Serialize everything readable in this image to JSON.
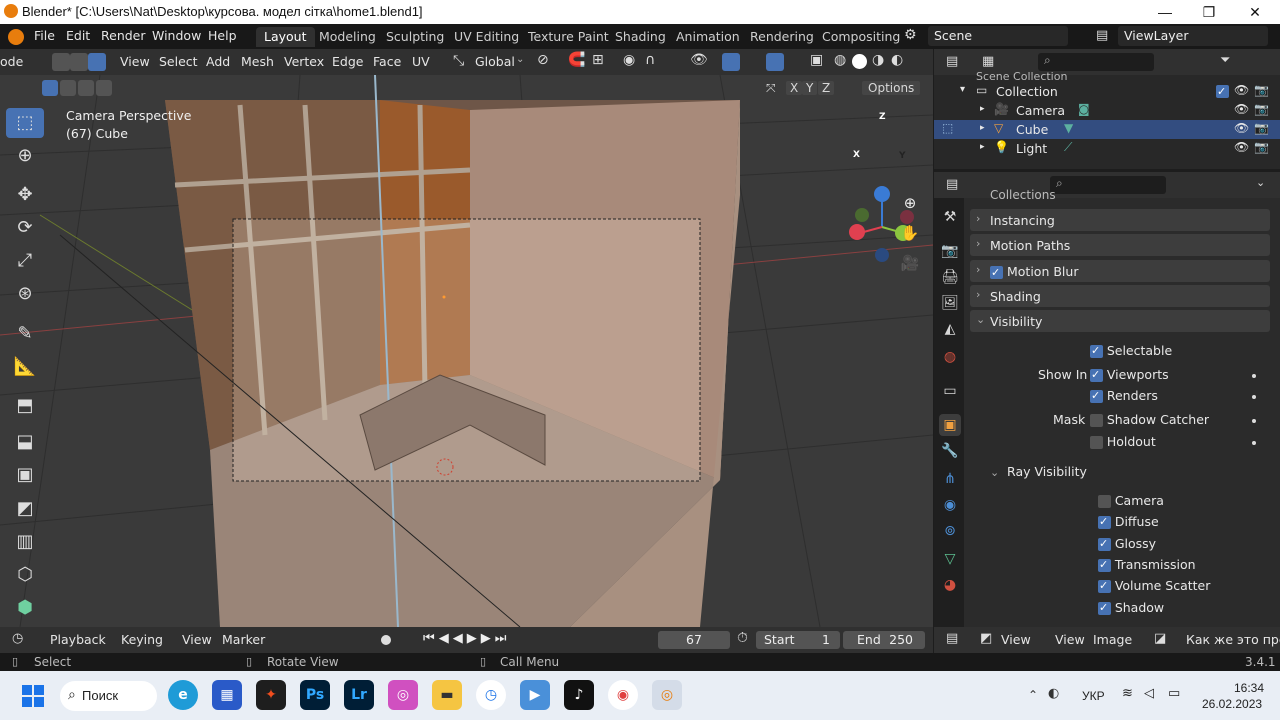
{
  "window": {
    "title": "Blender* [C:\\Users\\Nat\\Desktop\\курсова. модел сітка\\home1.blend1]",
    "min": "—",
    "max": "❐",
    "close": "✕"
  },
  "menu": {
    "items": [
      "File",
      "Edit",
      "Render",
      "Window",
      "Help"
    ],
    "workspaces": [
      "Layout",
      "Modeling",
      "Sculpting",
      "UV Editing",
      "Texture Paint",
      "Shading",
      "Animation",
      "Rendering",
      "Compositing"
    ],
    "scene": "Scene",
    "view_layer": "ViewLayer"
  },
  "header3d": {
    "mode": "ode",
    "view": "View",
    "select": "Select",
    "add": "Add",
    "mesh": "Mesh",
    "vertex": "Vertex",
    "edge": "Edge",
    "face": "Face",
    "uv": "UV",
    "orientation": "Global",
    "axis_x": "X",
    "axis_y": "Y",
    "axis_z": "Z",
    "options": "Options"
  },
  "viewport": {
    "perspective": "Camera Perspective",
    "object": "(67) Cube",
    "gizmo_x": "X",
    "gizmo_y": "Y",
    "gizmo_z": "Z"
  },
  "outliner": {
    "scene_collection": "Scene Collection",
    "collection": "Collection",
    "items": [
      {
        "label": "Camera"
      },
      {
        "label": "Cube"
      },
      {
        "label": "Light"
      }
    ]
  },
  "properties": {
    "collections": "Collections",
    "panels": [
      "Instancing",
      "Motion Paths",
      "Motion Blur",
      "Shading",
      "Visibility"
    ],
    "selectable": "Selectable",
    "show_in": "Show In",
    "viewports": "Viewports",
    "renders": "Renders",
    "mask": "Mask",
    "shadow_catcher": "Shadow Catcher",
    "holdout": "Holdout",
    "ray_visibility": "Ray Visibility",
    "rays": [
      {
        "label": "Camera",
        "checked": false
      },
      {
        "label": "Diffuse",
        "checked": true
      },
      {
        "label": "Glossy",
        "checked": true
      },
      {
        "label": "Transmission",
        "checked": true
      },
      {
        "label": "Volume Scatter",
        "checked": true
      },
      {
        "label": "Shadow",
        "checked": true
      }
    ]
  },
  "timeline": {
    "playback": "Playback",
    "keying": "Keying",
    "view": "View",
    "marker": "Marker",
    "current_frame": "67",
    "start_label": "Start",
    "start": "1",
    "end_label": "End",
    "end": "250",
    "right_view": "View",
    "right_view2": "View",
    "image": "Image",
    "search_text": "Как же это прек"
  },
  "status": {
    "select": "Select",
    "rotate": "Rotate View",
    "call_menu": "Call Menu",
    "version": "3.4.1"
  },
  "taskbar": {
    "search": "Поиск",
    "lang": "УКР",
    "time": "16:34",
    "date": "26.02.2023"
  },
  "colors": {
    "accent": "#4772b3",
    "selection": "#334d80",
    "orange": "#e87d0d"
  }
}
